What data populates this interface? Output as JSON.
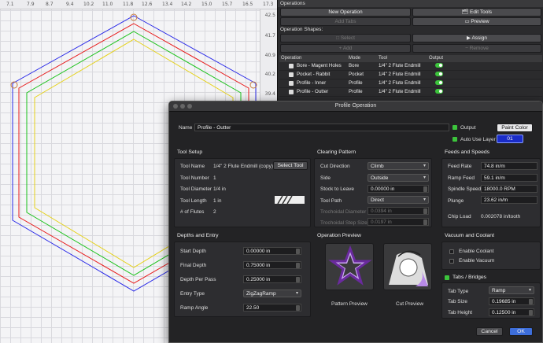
{
  "canvas": {
    "top_ticks": [
      "7.1",
      "7.9",
      "8.7",
      "9.4",
      "10.2",
      "11.0",
      "11.8",
      "12.6",
      "13.4",
      "14.2",
      "15.0",
      "15.7",
      "16.5",
      "17.3"
    ],
    "right_ticks": [
      "42.5",
      "41.7",
      "40.9",
      "40.2",
      "39.4"
    ],
    "colors": {
      "blue": "#2a2ae8",
      "red": "#e81a1a",
      "green": "#1ac21a",
      "yellow": "#e6d21a"
    }
  },
  "ops": {
    "title": "Operations",
    "new_operation": "New Operation",
    "edit_tools": "Edit Tools",
    "add_tabs": "Add Tabs",
    "preview": "Preview",
    "shapes_label": "Operation Shapes:",
    "select": "Select",
    "assign": "Assign",
    "add": "Add",
    "remove": "Remove",
    "headers": {
      "operation": "Operation",
      "mode": "Mode",
      "tool": "Tool",
      "output": "Output"
    },
    "rows": [
      {
        "name": "Bore - Magent Holes",
        "mode": "Bore",
        "tool": "1/4\" 2 Flute Endmill"
      },
      {
        "name": "Pocket - Rabbit",
        "mode": "Pocket",
        "tool": "1/4\" 2 Flute Endmill"
      },
      {
        "name": "Profile - Inner",
        "mode": "Profile",
        "tool": "1/4\" 2 Flute Endmill"
      },
      {
        "name": "Profile - Outter",
        "mode": "Profile",
        "tool": "1/4\" 2 Flute Endmill"
      }
    ]
  },
  "dialog": {
    "title": "Profile Operation",
    "name_label": "Name",
    "name_value": "Profile - Outter",
    "output_label": "Output",
    "paint_color": "Paint Color",
    "auto_use_layer": "Auto Use Layer",
    "layer_value": "01",
    "tool_setup": {
      "title": "Tool Setup",
      "tool_name_label": "Tool Name",
      "tool_name_value": "1/4\" 2 Flute Endmill (copy)",
      "select_tool": "Select Tool",
      "tool_number_label": "Tool Number",
      "tool_number_value": "1",
      "tool_diameter_label": "Tool Diameter",
      "tool_diameter_value": "1/4 in",
      "tool_length_label": "Tool Length",
      "tool_length_value": "1 in",
      "flutes_label": "# of Flutes",
      "flutes_value": "2"
    },
    "clearing": {
      "title": "Clearing Pattern",
      "cut_direction_label": "Cut Direction",
      "cut_direction_value": "Climb",
      "side_label": "Side",
      "side_value": "Outside",
      "stock_label": "Stock to Leave",
      "stock_value": "0.00000 in",
      "tool_path_label": "Tool Path",
      "tool_path_value": "Direct",
      "tro_diam_label": "Trochoidal Diameter",
      "tro_diam_value": "0.0394 in",
      "tro_step_label": "Trochoidal Step Size",
      "tro_step_value": "0.0197 in"
    },
    "feeds": {
      "title": "Feeds and Speeds",
      "feed_rate_label": "Feed Rate",
      "feed_rate_value": "74.8 in/m",
      "ramp_feed_label": "Ramp Feed",
      "ramp_feed_value": "59.1 in/m",
      "spindle_label": "Spindle Speed",
      "spindle_value": "18000.0 RPM",
      "plunge_label": "Plunge",
      "plunge_value": "23.62 in/m",
      "chip_label": "Chip Load",
      "chip_value": "0.002078 in/tooth"
    },
    "depths": {
      "title": "Depths and Entry",
      "start_label": "Start Depth",
      "start_value": "0.00000 in",
      "final_label": "Final Depth",
      "final_value": "0.75000 in",
      "per_pass_label": "Depth Per Pass",
      "per_pass_value": "0.25000 in",
      "entry_label": "Entry Type",
      "entry_value": "ZigZagRamp",
      "ramp_label": "Ramp Angle",
      "ramp_value": "22.50"
    },
    "op_preview": {
      "title": "Operation Preview",
      "pattern": "Pattern Preview",
      "cut": "Cut Preview"
    },
    "vacuum": {
      "title": "Vacuum and Coolant",
      "coolant": "Enable Coolant",
      "vacuum": "Enable Vacuum"
    },
    "tabs": {
      "title": "Tabs / Bridges",
      "type_label": "Tab Type",
      "type_value": "Ramp",
      "size_label": "Tab Size",
      "size_value": "0.19685 in",
      "height_label": "Tab Height",
      "height_value": "0.12500 in"
    },
    "cancel": "Cancel",
    "ok": "OK"
  }
}
